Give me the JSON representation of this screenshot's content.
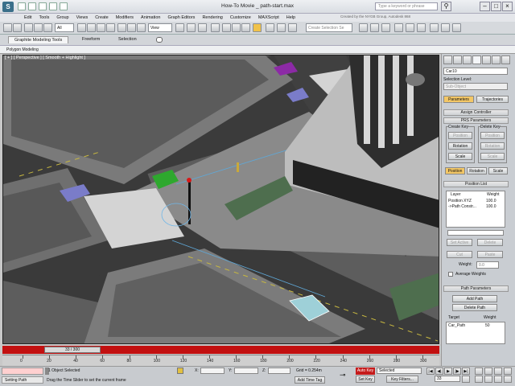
{
  "window": {
    "title": "How-To Movie _ path-start.max",
    "search_placeholder": "Type a keyword or phrase",
    "credit": "Created by the NYGB Group, Autodesk 868"
  },
  "menu": [
    "Edit",
    "Tools",
    "Group",
    "Views",
    "Create",
    "Modifiers",
    "Animation",
    "Graph Editors",
    "Rendering",
    "Customize",
    "MAXScript",
    "Help"
  ],
  "toolbar": {
    "filter": "All",
    "refcoord": "View",
    "selection_set": "Create Selection Se"
  },
  "ribbon": {
    "tabs": [
      "Graphite Modeling Tools",
      "Freeform",
      "Selection"
    ],
    "subtab": "Polygon Modeling"
  },
  "viewport": {
    "label": "[ + ] [ Perspective ] [ Smooth + Highlight ]"
  },
  "timeline": {
    "slider": "33 / 300",
    "ticks": [
      "0",
      "20",
      "40",
      "60",
      "80",
      "100",
      "120",
      "140",
      "160",
      "180",
      "200",
      "220",
      "240",
      "260",
      "280",
      "300"
    ]
  },
  "status": {
    "selection": "1 Object Selected",
    "prompt": "Drag the Time Slider to set the current frame",
    "x_label": "X:",
    "y_label": "Y:",
    "z_label": "Z:",
    "grid": "Grid = 0.254m",
    "add_time_tag": "Add Time Tag",
    "auto_key": "Auto Key",
    "set_key": "Set Key",
    "key_mode": "Selected",
    "key_filters": "Key Filters...",
    "frame": "33",
    "setting_path": "Setting Path"
  },
  "panel": {
    "object_name": "Car10",
    "selection_level": "Selection Level:",
    "sub_object": "Sub-Object",
    "tab_parameters": "Parameters",
    "tab_trajectories": "Trajectories",
    "assign_controller": "Assign Controller",
    "prs_parameters": "PRS Parameters",
    "create_key": "Create Key",
    "delete_key": "Delete Key",
    "position": "Position",
    "rotation": "Rotation",
    "scale": "Scale",
    "position_list": "Position List",
    "layer_col": "Layer",
    "weight_col": "Weight",
    "layers": [
      {
        "name": "Position XYZ",
        "weight": "100.0"
      },
      {
        "name": "->Path Constr...",
        "weight": "100.0"
      }
    ],
    "set_active": "Set Active",
    "delete": "Delete",
    "cut": "Cut",
    "paste": "Paste",
    "weight_label": "Weight:",
    "weight_value": "0.0",
    "average_weights": "Average Weights",
    "path_parameters": "Path Parameters",
    "add_path": "Add Path",
    "delete_path": "Delete Path",
    "target": "Target",
    "weight": "Weight",
    "targets": [
      {
        "name": "Car_Path",
        "weight": "50"
      }
    ]
  },
  "colors": {
    "time_bar": "#c21010",
    "auto_key": "#c51b1b",
    "highlight_button": "#f3c766"
  }
}
